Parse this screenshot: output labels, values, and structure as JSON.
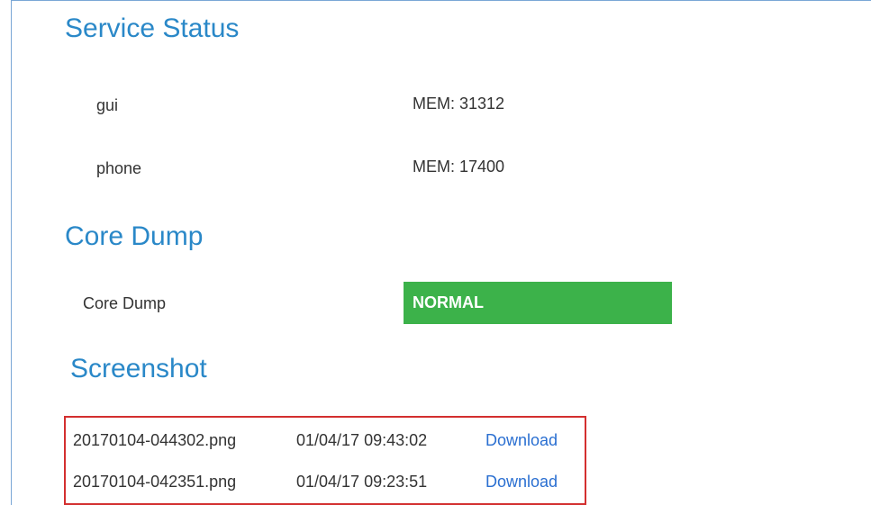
{
  "service_status": {
    "title": "Service Status",
    "items": [
      {
        "name": "gui",
        "value": "MEM: 31312"
      },
      {
        "name": "phone",
        "value": "MEM: 17400"
      }
    ]
  },
  "core_dump": {
    "title": "Core Dump",
    "label": "Core Dump",
    "status": "NORMAL",
    "status_color": "#3cb24a"
  },
  "screenshot": {
    "title": "Screenshot",
    "files": [
      {
        "filename": "20170104-044302.png",
        "timestamp": "01/04/17 09:43:02",
        "action": "Download"
      },
      {
        "filename": "20170104-042351.png",
        "timestamp": "01/04/17 09:23:51",
        "action": "Download"
      }
    ]
  },
  "colors": {
    "heading": "#2a88c8",
    "link": "#2a6fd1",
    "highlight_border": "#d32f2f"
  }
}
